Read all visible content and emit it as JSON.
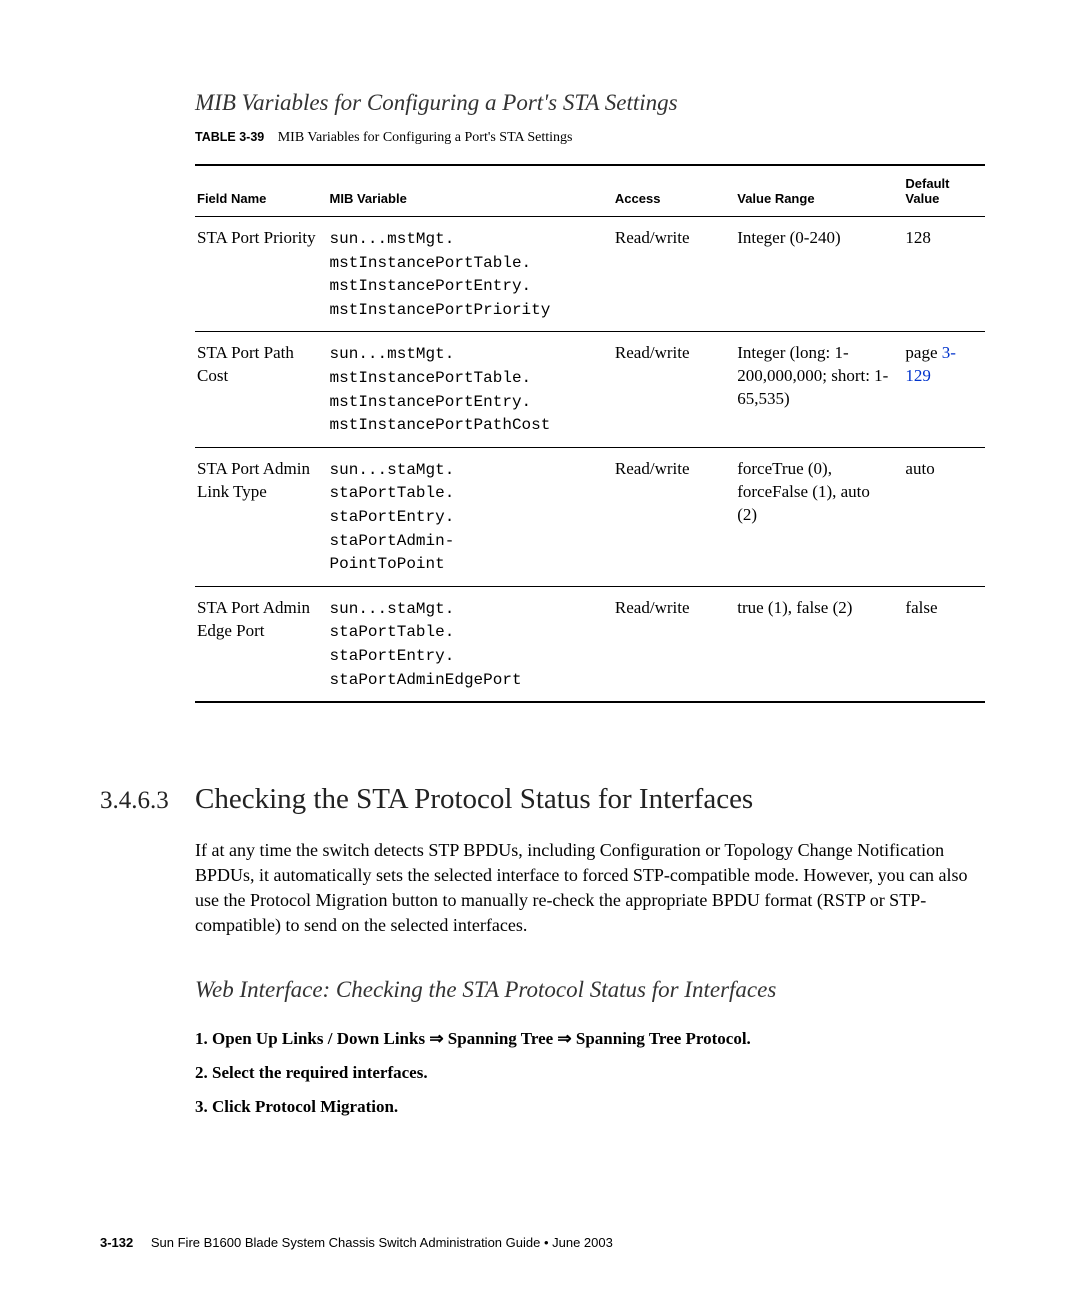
{
  "subtitle1": "MIB Variables for Configuring a Port's STA Settings",
  "table_caption_label": "TABLE 3-39",
  "table_caption_text": "MIB Variables for Configuring a Port's STA Settings",
  "table": {
    "headers": {
      "c1": "Field Name",
      "c2": "MIB Variable",
      "c3": "Access",
      "c4": "Value Range",
      "c5": "Default Value"
    },
    "rows": [
      {
        "field": "STA Port Priority",
        "mib": "sun...mstMgt.\nmstInstancePortTable.\nmstInstancePortEntry.\nmstInstancePortPriority",
        "access": "Read/write",
        "range": "Integer (0-240)",
        "def": "128",
        "def_link": ""
      },
      {
        "field": "STA Port Path Cost",
        "mib": "sun...mstMgt.\nmstInstancePortTable.\nmstInstancePortEntry.\nmstInstancePortPathCost",
        "access": "Read/write",
        "range": "Integer (long: 1-200,000,000; short: 1-65,535)",
        "def": "page ",
        "def_link": "3-129"
      },
      {
        "field": "STA Port Admin Link Type",
        "mib": "sun...staMgt.\nstaPortTable.\nstaPortEntry.\nstaPortAdmin-\nPointToPoint",
        "access": "Read/write",
        "range": "forceTrue (0), forceFalse (1), auto (2)",
        "def": "auto",
        "def_link": ""
      },
      {
        "field": "STA Port Admin Edge Port",
        "mib": "sun...staMgt.\nstaPortTable.\nstaPortEntry.\nstaPortAdminEdgePort",
        "access": "Read/write",
        "range": "true (1), false (2)",
        "def": "false",
        "def_link": ""
      }
    ]
  },
  "section_num": "3.4.6.3",
  "section_title": "Checking the STA Protocol Status for Interfaces",
  "para": "If at any time the switch detects STP BPDUs, including Configuration or Topology Change Notification BPDUs, it automatically sets the selected interface to forced STP-compatible mode. However, you can also use the Protocol Migration button to manually re-check the appropriate BPDU format (RSTP or STP-compatible) to send on the selected interfaces.",
  "subtitle2": "Web Interface: Checking the STA Protocol Status for Interfaces",
  "steps": [
    "Open Up Links / Down Links ⇒ Spanning Tree ⇒ Spanning Tree Protocol.",
    "Select the required interfaces.",
    "Click Protocol Migration."
  ],
  "footer_page": "3-132",
  "footer_text": "Sun Fire B1600 Blade System Chassis Switch Administration Guide • June 2003"
}
